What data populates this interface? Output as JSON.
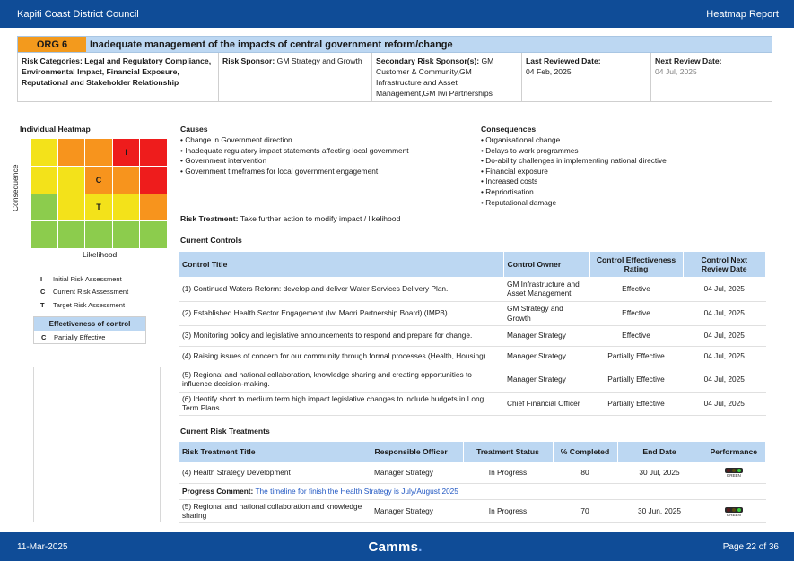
{
  "header": {
    "org": "Kapiti Coast District Council",
    "report": "Heatmap Report"
  },
  "risk": {
    "code": "ORG 6",
    "title": "Inadequate management of the impacts of central government reform/change",
    "categories_label": "Risk Categories:",
    "categories": "Legal and Regulatory Compliance, Environmental Impact, Financial Exposure, Reputational and Stakeholder Relationship",
    "sponsor_label": "Risk Sponsor:",
    "sponsor": "GM Strategy and Growth",
    "secondary_label": "Secondary Risk Sponsor(s):",
    "secondary": "GM Customer & Community,GM Infrastructure and Asset Management,GM Iwi Partnerships",
    "last_reviewed_label": "Last Reviewed Date:",
    "last_reviewed": "04 Feb, 2025",
    "next_review_label": "Next Review Date:",
    "next_review": "04 Jul, 2025"
  },
  "heatmap": {
    "title": "Individual Heatmap",
    "y_label": "Consequence",
    "x_label": "Likelihood",
    "colors": {
      "red": "#ee1c1c",
      "orange": "#f7941d",
      "yellow": "#f3e21a",
      "green": "#8ccc4d"
    },
    "grid": [
      [
        "yellow",
        "orange",
        "orange",
        "red",
        "red"
      ],
      [
        "yellow",
        "yellow",
        "orange",
        "orange",
        "red"
      ],
      [
        "green",
        "yellow",
        "yellow",
        "yellow",
        "orange"
      ],
      [
        "green",
        "green",
        "green",
        "green",
        "green"
      ]
    ],
    "markers": [
      {
        "row": 0,
        "col": 3,
        "label": "I"
      },
      {
        "row": 1,
        "col": 2,
        "label": "C"
      },
      {
        "row": 2,
        "col": 2,
        "label": "T"
      }
    ],
    "legend": [
      {
        "key": "I",
        "text": "Initial Risk Assessment"
      },
      {
        "key": "C",
        "text": "Current Risk Assessment"
      },
      {
        "key": "T",
        "text": "Target Risk Assessment"
      }
    ],
    "effectiveness_title": "Effectiveness of control",
    "effectiveness": {
      "key": "C",
      "text": "Partially Effective"
    }
  },
  "causes": {
    "title": "Causes",
    "items": [
      "Change in Government direction",
      "Inadequate regulatory impact statements affecting local government",
      "Government intervention",
      "Government timeframes for local government engagement"
    ]
  },
  "consequences": {
    "title": "Consequences",
    "items": [
      "Organisational change",
      "Delays to work programmes",
      "Do-ability challenges in implementing national directive",
      "Financial exposure",
      "Increased costs",
      "Repriortisation",
      "Reputational damage"
    ]
  },
  "risk_treatment": {
    "label": "Risk Treatment:",
    "value": "Take further action to modify impact / likelihood"
  },
  "controls": {
    "title": "Current Controls",
    "headers": [
      "Control Title",
      "Control Owner",
      "Control Effectiveness Rating",
      "Control Next Review Date"
    ],
    "rows": [
      [
        "(1) Continued Waters Reform: develop and deliver Water Services Delivery Plan.",
        "GM Infrastructure and Asset Management",
        "Effective",
        "04 Jul, 2025"
      ],
      [
        "(2) Established Health Sector Engagement (Iwi Maori Partnership Board) (IMPB)",
        "GM Strategy and Growth",
        "Effective",
        "04 Jul, 2025"
      ],
      [
        "(3) Monitoring policy and legislative announcements to respond and prepare for change.",
        "Manager Strategy",
        "Effective",
        "04 Jul, 2025"
      ],
      [
        "(4) Raising issues of concern for our community through formal processes (Health, Housing)",
        "Manager Strategy",
        "Partially Effective",
        "04 Jul, 2025"
      ],
      [
        "(5) Regional and national collaboration, knowledge sharing and creating opportunities to influence decision-making.",
        "Manager Strategy",
        "Partially Effective",
        "04 Jul, 2025"
      ],
      [
        "(6) Identify short to medium term high impact legislative changes to include budgets in Long Term Plans",
        "Chief Financial Officer",
        "Partially Effective",
        "04 Jul, 2025"
      ]
    ]
  },
  "treatments": {
    "title": "Current Risk Treatments",
    "headers": [
      "Risk Treatment Title",
      "Responsible Officer",
      "Treatment Status",
      "% Completed",
      "End Date",
      "Performance"
    ],
    "rows": [
      {
        "title": "(4) Health Strategy Development",
        "officer": "Manager Strategy",
        "status": "In Progress",
        "completed": "80",
        "end": "30 Jul, 2025",
        "performance": "GREEN",
        "comment_label": "Progress Comment:",
        "comment": "The timeline for finish the Health Strategy is July/August 2025"
      },
      {
        "title": "(5) Regional and national collaboration and knowledge sharing",
        "officer": "Manager Strategy",
        "status": "In Progress",
        "completed": "70",
        "end": "30 Jun, 2025",
        "performance": "GREEN"
      }
    ]
  },
  "footer": {
    "date": "11-Mar-2025",
    "brand": "Camms",
    "brand_dot": ".",
    "page": "Page 22 of 36"
  }
}
